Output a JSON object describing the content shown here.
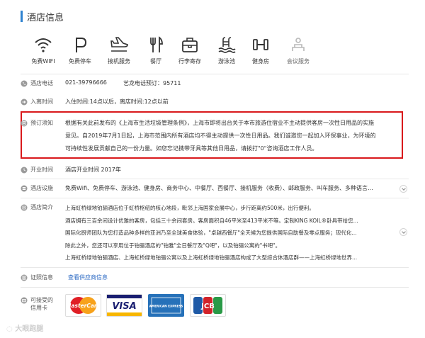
{
  "section_title": "酒店信息",
  "facilities": [
    {
      "label": "免费WIFI",
      "icon": "wifi-icon",
      "available": true
    },
    {
      "label": "免费停车",
      "icon": "parking-icon",
      "available": true
    },
    {
      "label": "接机服务",
      "icon": "airplane-icon",
      "available": true
    },
    {
      "label": "餐厅",
      "icon": "fork-knife-icon",
      "available": true
    },
    {
      "label": "行李寄存",
      "icon": "luggage-icon",
      "available": true
    },
    {
      "label": "游泳池",
      "icon": "swimming-pool-icon",
      "available": true
    },
    {
      "label": "健身房",
      "icon": "dumbbell-icon",
      "available": true
    },
    {
      "label": "会议服务",
      "icon": "meeting-icon",
      "available": false
    }
  ],
  "rows": {
    "phone": {
      "key": "酒店电话",
      "value": "021-39796666",
      "extra": "艺龙电话预订：95711"
    },
    "checkin": {
      "key": "入离时间",
      "value": "入住时间:14点以后，离店时间:12点以前"
    },
    "notice": {
      "key": "预订须知",
      "lines": [
        "根据有关此前发布的《上海市生活垃圾管理条例》，上海市即将出台关于本市旅游住宿业不主动提供客房一次性日用品的实施",
        "意见。自2019年7月1日起，上海市范围内所有酒店均不得主动提供一次性日用品。我们诚邀您一起加入环保事业，为环境的",
        "可持续性发展贡献自己的一份力量。如您忘记携带牙具等其他日用品，请拨打\"0\"咨询酒店工作人员。"
      ]
    },
    "opening": {
      "key": "开业时间",
      "value": "酒店开业时间 2017年"
    },
    "facilities_row": {
      "key": "酒店设施",
      "value": "免费Wifi、免费停车、游泳池、健身房、商务中心、中餐厅、西餐厅、接机服务（收费）、邮政服务、叫车服务、多种语言..."
    },
    "intro": {
      "key": "酒店简介",
      "lines": [
        "上海虹桥绿地铂骊酒店位于虹桥枢纽的核心地段，毗邻上海国家会展中心，步行距离约500米，出行便利。",
        "酒店拥有三百余间设计优雅的客房，包括三十余间套房。客房面积自46平米至413平米不等。定制KING KOIL®卧具带给您...",
        "国际化厨师团队为您打造品种多样的亚洲乃至全球美食体验，\"卓越西餐厅\"全天候为您提供国际自助餐及零点服务；现代化...",
        "除此之外，您还可以享用位于铂骊酒店的\"铂雅\"全日餐厅及\"Q吧\"，以及铂骊公寓的\"书吧\"。",
        "上海虹桥绿地铂骊酒店、上海虹桥绿地铂骊公寓以及上海虹桥绿地铂骊酒店构成了大型综合体酒店群——上海虹桥绿地世界..."
      ]
    },
    "cert": {
      "key": "证照信息",
      "link": "查看供应商信息"
    },
    "cards": {
      "key_line1": "可接受的",
      "key_line2": "信用卡",
      "items": [
        "MasterCard",
        "VISA",
        "AMERICAN EXPRESS",
        "JCB"
      ]
    }
  },
  "watermark": "大眼跑腿",
  "colors": {
    "accent": "#2e82d0",
    "highlight_border": "#d9191c",
    "link": "#2e6bc4"
  }
}
